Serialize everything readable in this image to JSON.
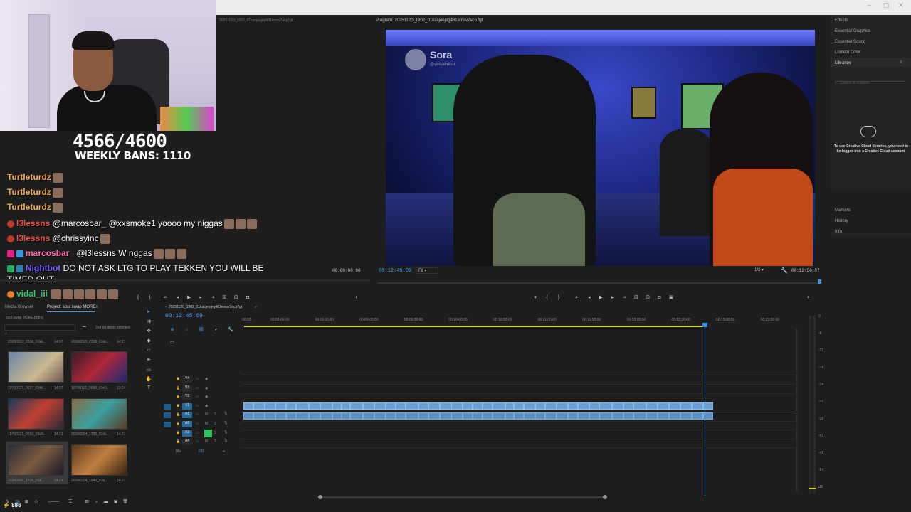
{
  "stream_overlay": {
    "ban_count": "4566/4600",
    "weekly_bans": "WEEKLY BANS: 1110"
  },
  "chat": {
    "messages": [
      {
        "user": "Turtleturdz",
        "text": "",
        "color": "#f5b041"
      },
      {
        "user": "Turtleturdz",
        "text": "",
        "color": "#f5b041"
      },
      {
        "user": "Turtleturdz",
        "text": "",
        "color": "#f5b041"
      },
      {
        "user": "l3lessns",
        "text": "@marcosbar_ @xxsmoke1 yoooo my niggas",
        "color": "#e74c3c"
      },
      {
        "user": "l3lessns",
        "text": "@chrissyinc",
        "color": "#e74c3c"
      },
      {
        "user": "marcosbar_",
        "text": "@l3lessns W nggas",
        "color": "#ff69b4"
      },
      {
        "user": "Nightbot",
        "text": "DO NOT ASK LTG TO PLAY TEKKEN YOU WILL BE",
        "color": "#7d5fff"
      },
      {
        "user": "",
        "text": "TIMED OUT",
        "color": "#ffffff"
      },
      {
        "user": "vidal_iii",
        "text": "",
        "color": "#2ecc71"
      }
    ],
    "viewer_count": "886"
  },
  "source_monitor": {
    "title": "20251120_1902_01kacjeojeg481emsv7acp7gt",
    "timecode": "00:00:00:00"
  },
  "program_monitor": {
    "title": "Program: 20251120_1902_01kacjeojeg481emsv7acp7gt",
    "current_timecode": "00:12:45:09",
    "fit_label": "Fit",
    "resolution": "1/2",
    "duration": "00:12:50:07",
    "watermark_brand": "Sora",
    "watermark_handle": "@virtualmind"
  },
  "right_panel": {
    "items": [
      "Effects",
      "Essential Graphics",
      "Essential Sound",
      "Lumetri Color",
      "Libraries"
    ],
    "search_placeholder": "Search all libraries",
    "cc_message": "To use Creative Cloud libraries, you need to be logged into a Creative Cloud account.",
    "lower_items": [
      "Markers",
      "History",
      "Info"
    ]
  },
  "project_panel": {
    "tabs": [
      "Media Browser",
      "Project: soul swap MORE"
    ],
    "project_file": "soul swap MORE.prproj",
    "selection_info": "3 of 98 items selected",
    "media": [
      {
        "name": "20260313_2338_01kk...",
        "duration": "14:07"
      },
      {
        "name": "20260313_2338_01kk...",
        "duration": "14:21"
      },
      {
        "name": "19700121_0637_69fd...",
        "duration": "14:07"
      },
      {
        "name": "19700121_0650_69c0...",
        "duration": "13:24"
      },
      {
        "name": "19700121_0650_69c0...",
        "duration": "14:21"
      },
      {
        "name": "20260324_1733_01kk...",
        "duration": "14:21"
      },
      {
        "name": "20260326_1725_01k...",
        "duration": "14:21"
      },
      {
        "name": "20260324_1940_01k...",
        "duration": "14:21"
      }
    ]
  },
  "timeline": {
    "sequence_name": "20251120_1902_01kacjeojeg481emsv7acp7gt",
    "timecode": "00:12:45:09",
    "ruler": [
      "00:00",
      "00:08:00:00",
      "00:08:30:00",
      "00:09:00:00",
      "00:09:30:00",
      "00:10:00:00",
      "00:10:30:00",
      "00:11:00:00",
      "00:11:30:00",
      "00:12:00:00",
      "00:12:30:00",
      "00:13:00:00",
      "00:13:30:00"
    ],
    "tracks": [
      {
        "id": "V4",
        "type": "video"
      },
      {
        "id": "V3",
        "type": "video"
      },
      {
        "id": "V2",
        "type": "video"
      },
      {
        "id": "V1",
        "type": "video"
      },
      {
        "id": "A1",
        "type": "audio"
      },
      {
        "id": "A2",
        "type": "audio"
      },
      {
        "id": "A3",
        "type": "audio"
      },
      {
        "id": "A4",
        "type": "audio"
      }
    ],
    "mix_label": "Mix",
    "mix_value": "0.0"
  },
  "meter_scale": [
    "0",
    "-6",
    "-12",
    "-18",
    "-24",
    "-30",
    "-36",
    "-42",
    "-48",
    "-54",
    "dB"
  ],
  "colors": {
    "accent_blue": "#4b9df0",
    "clip_blue": "#6aa0d6",
    "playhead": "#3a8ee6",
    "work_area": "#d4d44a"
  }
}
